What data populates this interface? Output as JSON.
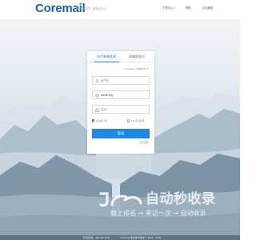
{
  "header": {
    "logo": "Coremail",
    "slogan": "全程服务历 · 更亲近办公",
    "nav": {
      "download": "下载中心",
      "help": "帮助",
      "enterprise": "企业服务"
    }
  },
  "login": {
    "tabs": [
      "电子邮箱登录",
      "邮箱管理员"
    ],
    "active_tab_index": 0,
    "language": "简体中文",
    "language_prefix": "Language:",
    "username_placeholder": "用户名",
    "domain_value": "xxmib.org",
    "password_placeholder": "密 码",
    "remember_label": "记住用户名",
    "remember_checked": true,
    "ssl_label": "SSL安全登录",
    "ssl_checked": false,
    "submit_label": "登录",
    "forgot_label": "忘记密码"
  },
  "watermark": {
    "title": "自动秒收录",
    "subtitle": "做上排名 → 来访一次 → 自动收录"
  },
  "footer": {
    "phone": "售前咨询：400-000-1631",
    "copyright": "Coremail 盈世邮件版本 © 2002 - 2016"
  },
  "colors": {
    "brand": "#1a5fb4",
    "accent": "#1e88e5",
    "footer_bg": "#5e7486"
  }
}
